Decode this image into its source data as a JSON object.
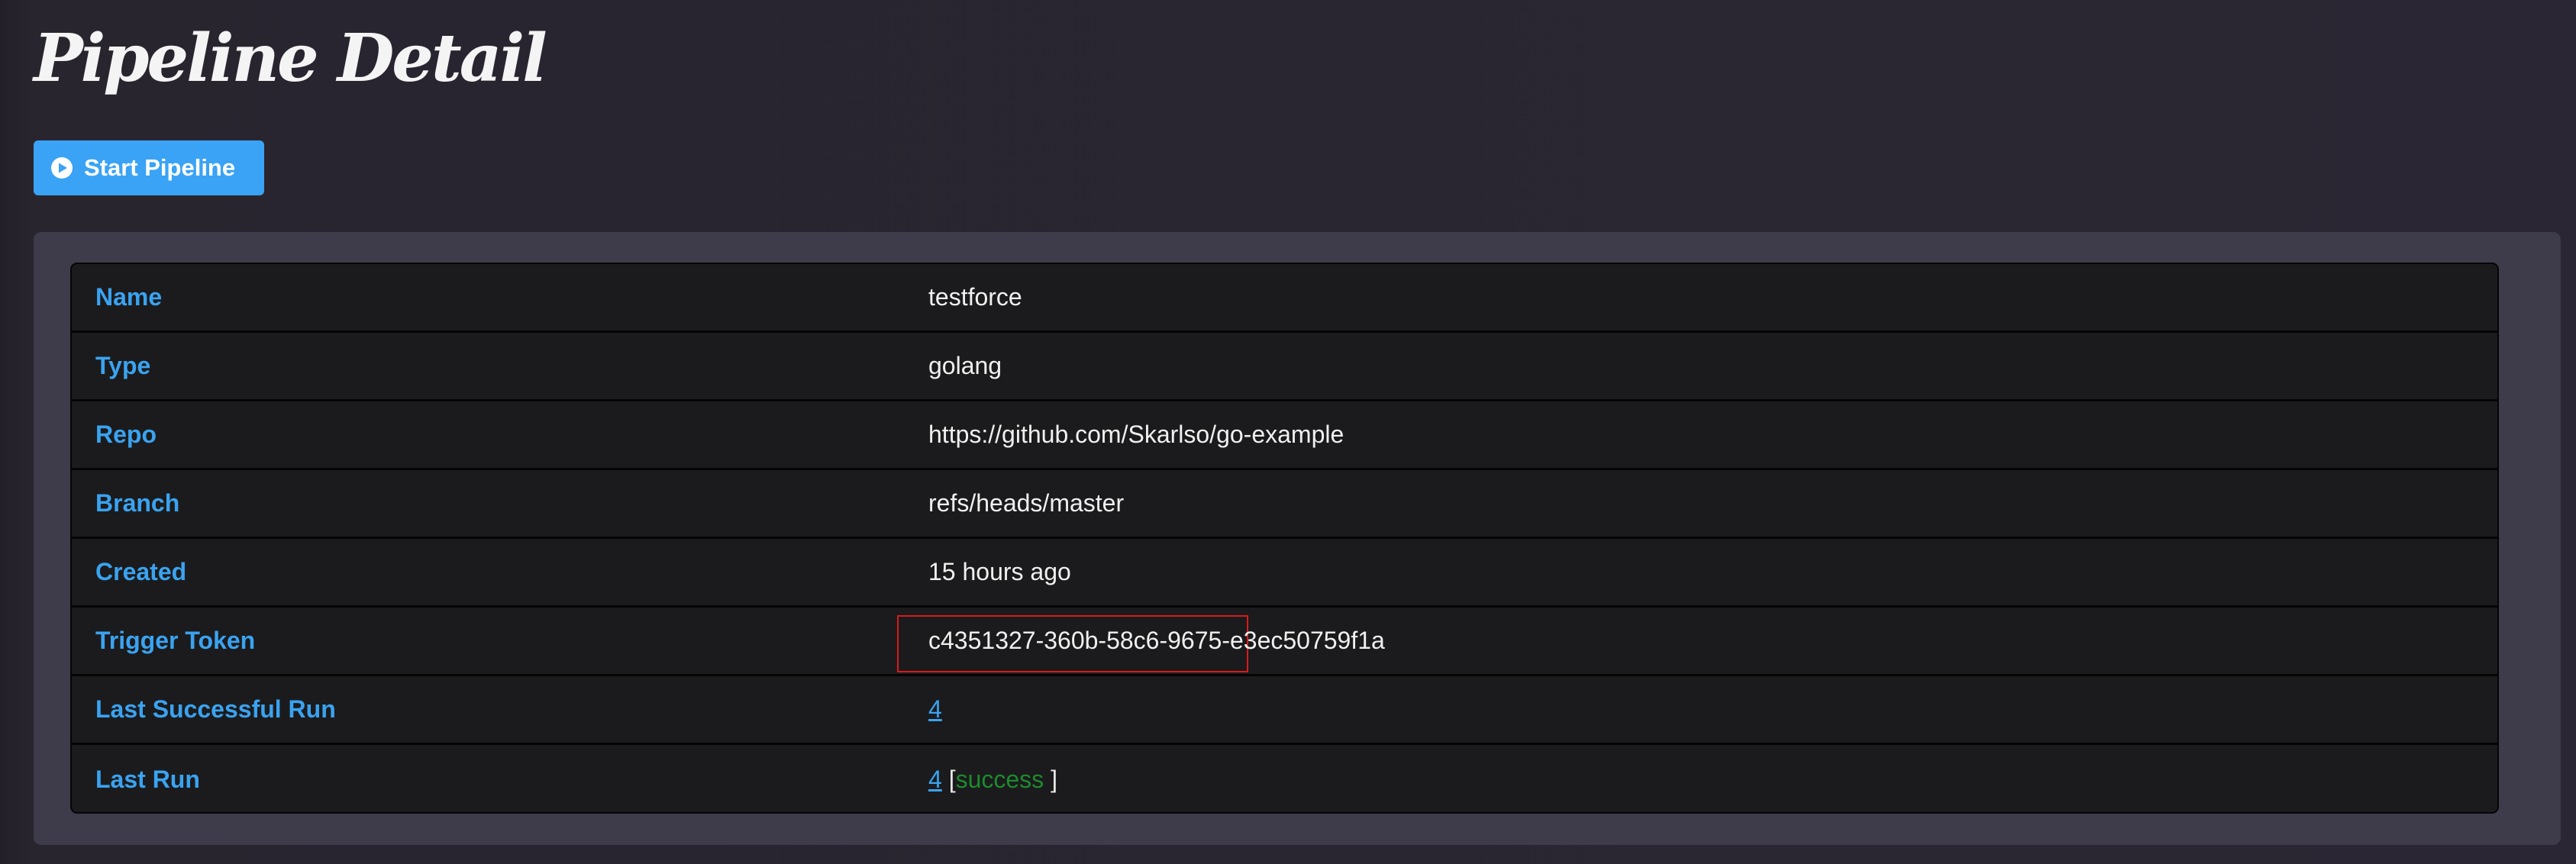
{
  "page": {
    "title": "Pipeline Detail"
  },
  "toolbar": {
    "start_button_label": "Start Pipeline",
    "start_button_icon": "play-circle-icon",
    "accent_color": "#3aa3f5"
  },
  "details": {
    "rows": [
      {
        "label": "Name",
        "value": "testforce"
      },
      {
        "label": "Type",
        "value": "golang"
      },
      {
        "label": "Repo",
        "value": "https://github.com/Skarlso/go-example"
      },
      {
        "label": "Branch",
        "value": "refs/heads/master"
      },
      {
        "label": "Created",
        "value": "15 hours ago"
      },
      {
        "label": "Trigger Token",
        "value": "c4351327-360b-58c6-9675-e3ec50759f1a",
        "highlighted": true
      },
      {
        "label": "Last Successful Run",
        "value": "4",
        "link": true
      },
      {
        "label": "Last Run",
        "value": "4",
        "link": true,
        "status_open": "[",
        "status": "success",
        "status_close": " ]"
      }
    ]
  },
  "colors": {
    "label": "#3aa3f0",
    "success": "#1e8a2e",
    "highlight_border": "#d81b1b"
  }
}
